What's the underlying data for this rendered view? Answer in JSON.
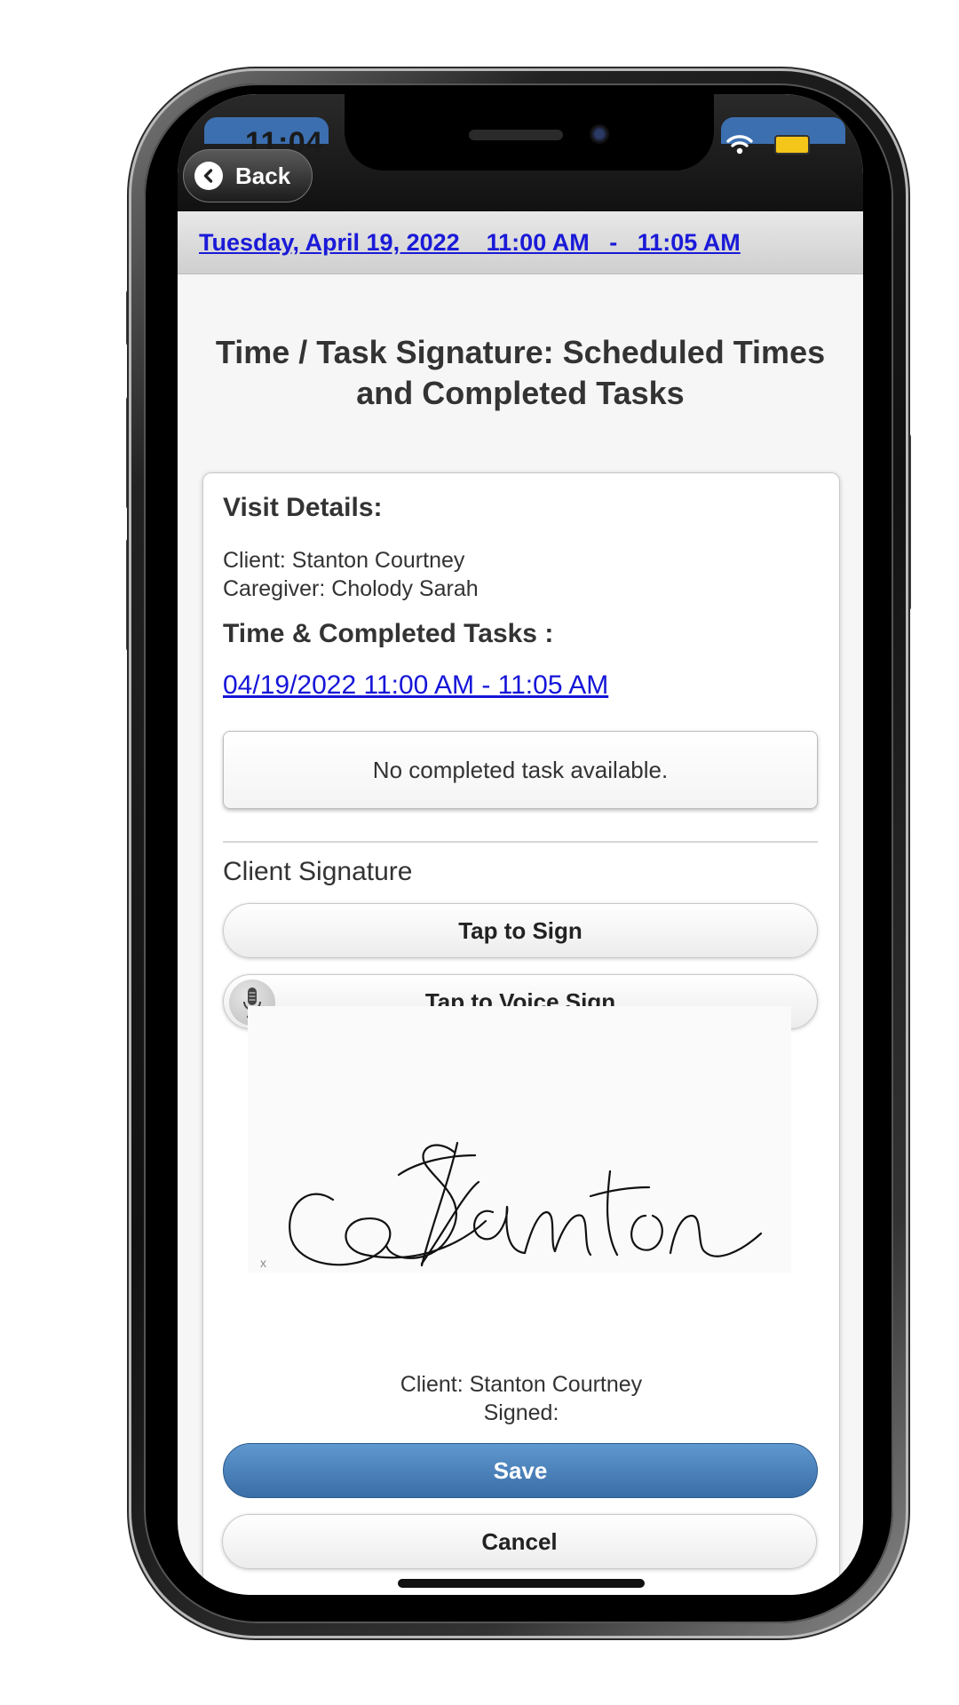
{
  "status_bar": {
    "time": "11:04",
    "wifi_icon": "wifi-icon",
    "battery_icon": "battery-icon",
    "battery_color": "#f4c619"
  },
  "header": {
    "back_label": "Back",
    "back_icon": "chevron-left-icon"
  },
  "date_bar": {
    "date_text": "Tuesday, April 19, 2022    11:00 AM   -   11:05 AM"
  },
  "page": {
    "title": "Time / Task Signature: Scheduled Times and Completed Tasks"
  },
  "visit": {
    "heading": "Visit Details:",
    "client_line": "Client: Stanton Courtney",
    "caregiver_line": "Caregiver: Cholody Sarah",
    "tasks_heading": "Time & Completed Tasks :",
    "range_link": "04/19/2022 11:00 AM - 11:05 AM",
    "no_task_text": "No completed task available."
  },
  "signature": {
    "label": "Client Signature",
    "tap_sign_label": "Tap to Sign",
    "voice_sign_label": "Tap to Voice Sign",
    "voice_icon": "microphone-icon",
    "signature_text": "Stanton",
    "client_line": "Client: Stanton Courtney",
    "signed_line": "Signed:"
  },
  "actions": {
    "save_label": "Save",
    "cancel_label": "Cancel",
    "save_color": "#4a80ba"
  }
}
